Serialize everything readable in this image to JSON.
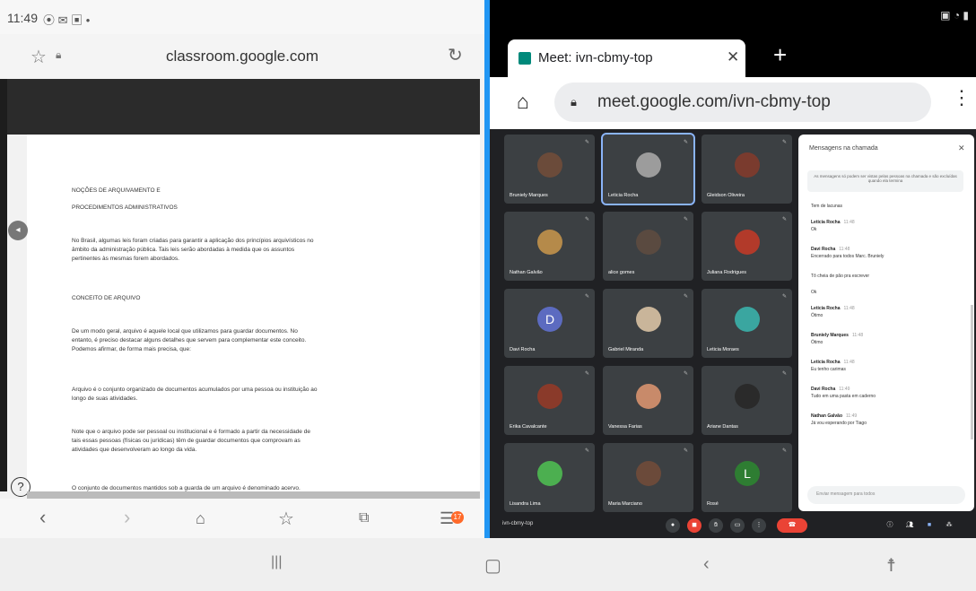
{
  "left": {
    "status": {
      "time": "11:49",
      "icons": "⦿ ✉ ▣ •"
    },
    "address": {
      "url": "classroom.google.com"
    },
    "doc": {
      "lines": [
        "NOÇÕES DE ARQUIVAMENTO E",
        "PROCEDIMENTOS ADMINISTRATIVOS",
        "No Brasil, algumas leis foram criadas para garantir a aplicação dos princípios arquivísticos no",
        "âmbito da administração pública. Tais leis serão abordadas à medida que os assuntos",
        "pertinentes às mesmas forem abordados.",
        "CONCEITO DE ARQUIVO",
        "De um modo geral, arquivo é aquele local que utilizamos para guardar documentos. No",
        "entanto, é preciso destacar alguns detalhes que servem para complementar este conceito.",
        "Podemos afirmar, de forma mais precisa, que:",
        "Arquivo é o conjunto organizado de documentos acumulados por uma pessoa ou instituição ao",
        "longo de suas atividades.",
        "Note que o arquivo pode ser pessoal ou institucional e é formado a partir da necessidade de",
        "tais essas pessoas (físicas ou jurídicas) têm de guardar documentos que comprovam as",
        "atividades que desenvolveram ao longo da vida.",
        "O conjunto de documentos mantidos sob a guarda de um arquivo é denominado acervo."
      ]
    },
    "badge": "17"
  },
  "right": {
    "tab": {
      "title": "Meet: ivn-cbmy-top"
    },
    "omnibox": {
      "url": "meet.google.com/ivn-cbmy-top"
    },
    "tiles": [
      {
        "name": "Bruniely Marques",
        "color": "#6b4b3a"
      },
      {
        "name": "Leticia Rocha",
        "color": "#9c9c9c"
      },
      {
        "name": "Gleidson Oliveira",
        "color": "#7a3b2e"
      },
      {
        "name": "Nathan Galvão",
        "color": "#b58a4a"
      },
      {
        "name": "alice gomes",
        "color": "#5a4a40"
      },
      {
        "name": "Juliana Rodrigues",
        "color": "#b23a2a"
      },
      {
        "name": "Davi Rocha",
        "letter": "D",
        "color": "#5c6bc0"
      },
      {
        "name": "Gabriel Miranda",
        "color": "#c9b59a"
      },
      {
        "name": "Leticia Moraes",
        "color": "#3aa6a0"
      },
      {
        "name": "Erika Cavalcante",
        "color": "#8a3a2a"
      },
      {
        "name": "Vanessa Farias",
        "color": "#c88a6a"
      },
      {
        "name": "Ariane Dantas",
        "color": "#2a2a2a"
      },
      {
        "name": "Lisandra Lima",
        "color": "#4caf50"
      },
      {
        "name": "Maria Marciano",
        "color": "#6b4a3a"
      },
      {
        "name": "Rosé",
        "letter": "L",
        "color": "#2e7d32"
      }
    ],
    "chat": {
      "header": "Mensagens na chamada",
      "notice": "As mensagens só podem ser vistas pelas pessoas na chamada e são excluídas quando ela termina",
      "messages": [
        {
          "who": "",
          "time": "",
          "text": "Tem de lacunas"
        },
        {
          "who": "Leticia Rocha",
          "time": "11:48",
          "text": "Ok"
        },
        {
          "who": "Davi Rocha",
          "time": "11:48",
          "text": "Encerrado para todos Marc. Bruniely"
        },
        {
          "who": "",
          "time": "",
          "text": "Tô cheia de pão pra escrever"
        },
        {
          "who": "",
          "time": "",
          "text": "Ok"
        },
        {
          "who": "Leticia Rocha",
          "time": "11:48",
          "text": "Ótimo"
        },
        {
          "who": "Bruniely Marques",
          "time": "11:48",
          "text": "Ótimo"
        },
        {
          "who": "Leticia Rocha",
          "time": "11:48",
          "text": "Eu tenho carimas"
        },
        {
          "who": "Davi Rocha",
          "time": "11:49",
          "text": "Tudo em uma pasta em caderno"
        },
        {
          "who": "Nathan Galvão",
          "time": "11:49",
          "text": "Já vou esperando por Tiago"
        }
      ],
      "input_placeholder": "Enviar mensagem para todos"
    },
    "meeting_code": "ivn-cbmy-top"
  }
}
